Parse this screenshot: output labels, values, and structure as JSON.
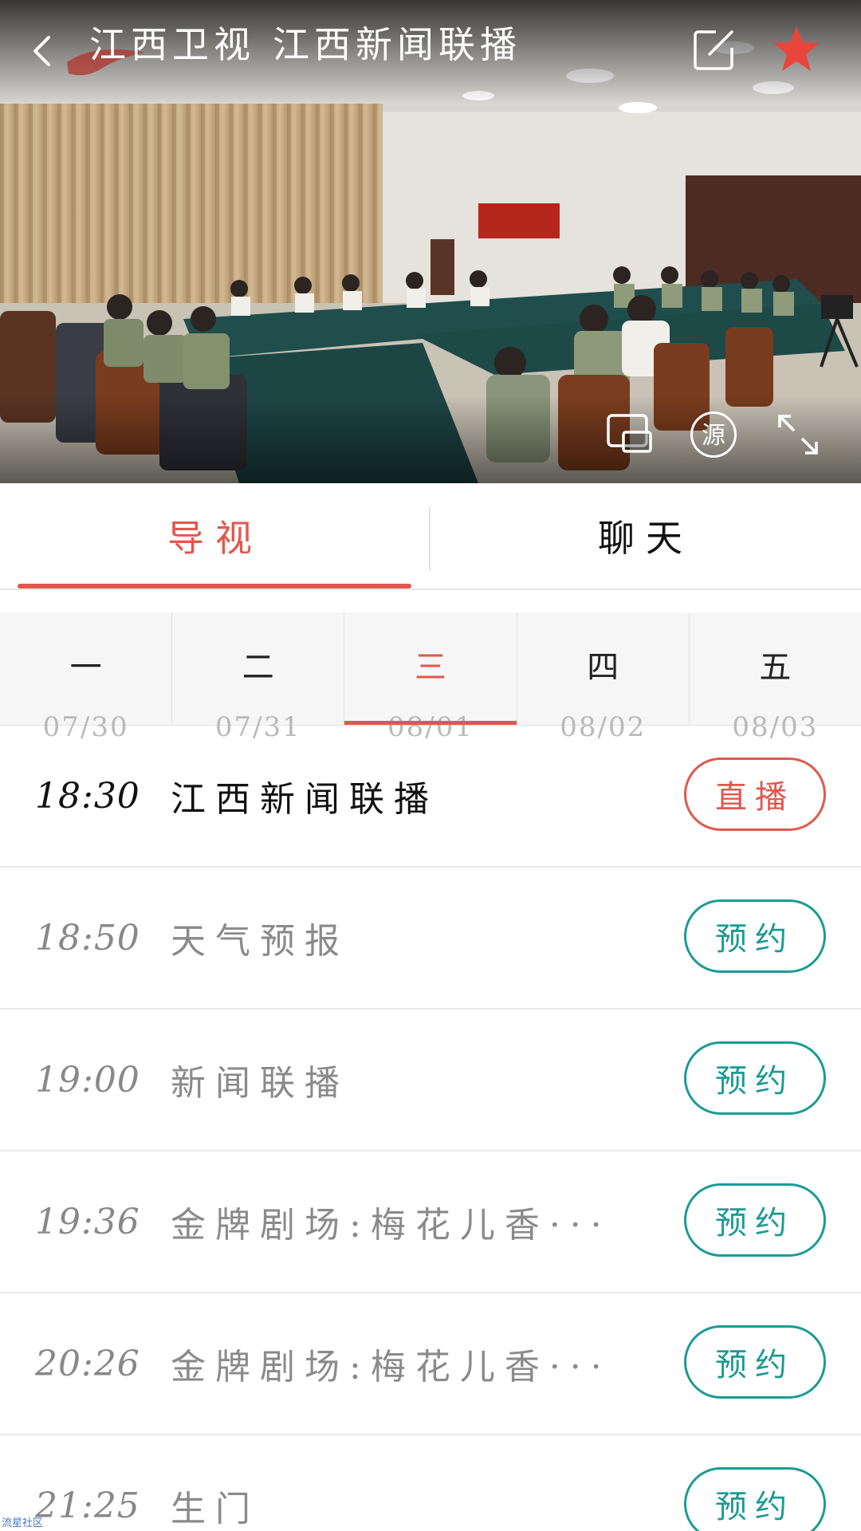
{
  "video": {
    "channel_name": "江西卫视",
    "program_name": "江西新闻联播",
    "source_label": "源"
  },
  "main_tabs": [
    {
      "label": "导视",
      "active": true
    },
    {
      "label": "聊天",
      "active": false
    }
  ],
  "days": [
    {
      "weekday": "一",
      "date": "07/30",
      "active": false
    },
    {
      "weekday": "二",
      "date": "07/31",
      "active": false
    },
    {
      "weekday": "三",
      "date": "08/01",
      "active": true
    },
    {
      "weekday": "四",
      "date": "08/02",
      "active": false
    },
    {
      "weekday": "五",
      "date": "08/03",
      "active": false
    }
  ],
  "programs": [
    {
      "time": "18:30",
      "title": "江西新闻联播",
      "action": "直播",
      "status": "live"
    },
    {
      "time": "18:50",
      "title": "天气预报",
      "action": "预约",
      "status": "upcoming"
    },
    {
      "time": "19:00",
      "title": "新闻联播",
      "action": "预约",
      "status": "upcoming"
    },
    {
      "time": "19:36",
      "title": "金牌剧场:梅花儿香···",
      "action": "预约",
      "status": "upcoming"
    },
    {
      "time": "20:26",
      "title": "金牌剧场:梅花儿香···",
      "action": "预约",
      "status": "upcoming"
    },
    {
      "time": "21:25",
      "title": "生门",
      "action": "预约",
      "status": "upcoming"
    }
  ],
  "watermark": "流星社区",
  "colors": {
    "accent_red": "#e2574c",
    "accent_teal": "#1a9b93",
    "favorite_red": "#e8453c"
  },
  "icons": {
    "back": "chevron-left-icon",
    "edit": "edit-icon",
    "favorite": "star-icon",
    "pip": "picture-in-picture-icon",
    "fullscreen": "expand-icon"
  }
}
